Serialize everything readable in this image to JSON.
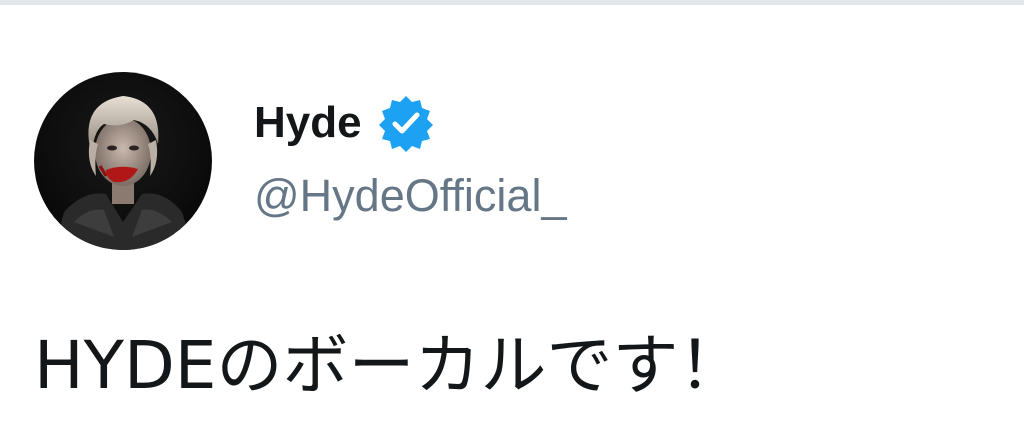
{
  "tweet": {
    "author": {
      "display_name": "Hyde",
      "handle": "@HydeOfficial_",
      "verified": true,
      "verified_icon": "verified-badge-icon",
      "avatar": "avatar-photo"
    },
    "text": "HYDEのボーカルです！"
  },
  "colors": {
    "verified_badge": "#1da1f2",
    "handle": "#657786",
    "name": "#14171a",
    "divider": "#e1e8ed"
  }
}
